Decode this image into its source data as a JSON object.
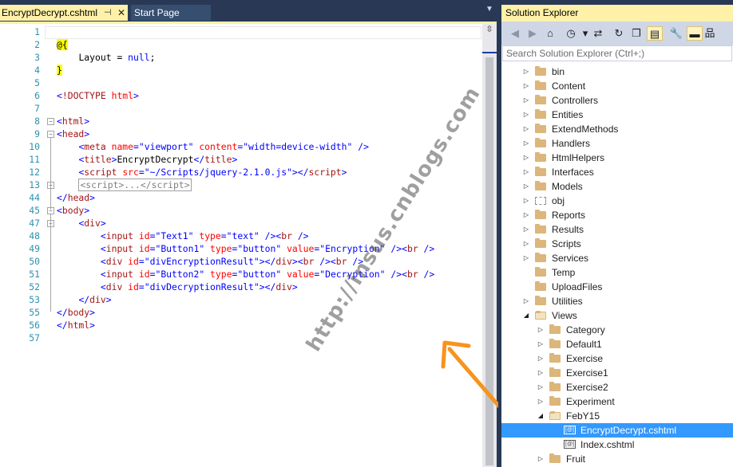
{
  "tabs": [
    {
      "label": "EncryptDecrypt.cshtml",
      "active": true
    },
    {
      "label": "Start Page",
      "active": false
    }
  ],
  "icons": {
    "pin": "⊣",
    "close": "✕",
    "dropdown": "▼",
    "split": "⇳",
    "fold_open": "−",
    "fold_closed": "+"
  },
  "editor": {
    "lines": [
      {
        "num": "1",
        "html": ""
      },
      {
        "num": "2",
        "html": "<span class=\"razor\">@{</span>"
      },
      {
        "num": "3",
        "html": "    <span class=\"txt\">Layout = </span><span class=\"kw\">null</span><span class=\"txt\">;</span>"
      },
      {
        "num": "4",
        "html": "<span class=\"razor\">}</span>"
      },
      {
        "num": "5",
        "html": ""
      },
      {
        "num": "6",
        "html": "<span class=\"val\">&lt;</span><span class=\"tag\">!DOCTYPE</span> <span class=\"attr\">html</span><span class=\"val\">&gt;</span>"
      },
      {
        "num": "7",
        "html": ""
      },
      {
        "num": "8",
        "html": "<span class=\"val\">&lt;</span><span class=\"tag\">html</span><span class=\"val\">&gt;</span>"
      },
      {
        "num": "9",
        "html": "<span class=\"val\">&lt;</span><span class=\"tag\">head</span><span class=\"val\">&gt;</span>"
      },
      {
        "num": "10",
        "html": "    <span class=\"val\">&lt;</span><span class=\"tag\">meta</span> <span class=\"attr\">name</span><span class=\"val\">=\"viewport\"</span> <span class=\"attr\">content</span><span class=\"val\">=\"width=device-width\"</span> <span class=\"val\">/&gt;</span>"
      },
      {
        "num": "11",
        "html": "    <span class=\"val\">&lt;</span><span class=\"tag\">title</span><span class=\"val\">&gt;</span><span class=\"txt\">EncryptDecrypt</span><span class=\"val\">&lt;/</span><span class=\"tag\">title</span><span class=\"val\">&gt;</span>"
      },
      {
        "num": "12",
        "html": "    <span class=\"val\">&lt;</span><span class=\"tag\">script</span> <span class=\"attr\">src</span><span class=\"val\">=\"~/Scripts/jquery-2.1.0.js\"</span><span class=\"val\">&gt;&lt;/</span><span class=\"tag\">script</span><span class=\"val\">&gt;</span>"
      },
      {
        "num": "13",
        "html": "    <span class=\"collapsed\">&lt;script&gt;...&lt;/script&gt;</span>"
      },
      {
        "num": "44",
        "html": "<span class=\"val\">&lt;/</span><span class=\"tag\">head</span><span class=\"val\">&gt;</span>"
      },
      {
        "num": "45",
        "html": "<span class=\"val\">&lt;</span><span class=\"tag\">body</span><span class=\"val\">&gt;</span>"
      },
      {
        "num": "47",
        "html": "    <span class=\"val\">&lt;</span><span class=\"tag\">div</span><span class=\"val\">&gt;</span>"
      },
      {
        "num": "48",
        "html": "        <span class=\"val\">&lt;</span><span class=\"tag\">input</span> <span class=\"attr\">id</span><span class=\"val\">=\"Text1\"</span> <span class=\"attr\">type</span><span class=\"val\">=\"text\"</span> <span class=\"val\">/&gt;&lt;</span><span class=\"tag\">br</span> <span class=\"val\">/&gt;</span>"
      },
      {
        "num": "49",
        "html": "        <span class=\"val\">&lt;</span><span class=\"tag\">input</span> <span class=\"attr\">id</span><span class=\"val\">=\"Button1\"</span> <span class=\"attr\">type</span><span class=\"val\">=\"button\"</span> <span class=\"attr\">value</span><span class=\"val\">=\"Encryption\"</span> <span class=\"val\">/&gt;&lt;</span><span class=\"tag\">br</span> <span class=\"val\">/&gt;</span>"
      },
      {
        "num": "50",
        "html": "        <span class=\"val\">&lt;</span><span class=\"tag\">div</span> <span class=\"attr\">id</span><span class=\"val\">=\"divEncryptionResult\"</span><span class=\"val\">&gt;&lt;/</span><span class=\"tag\">div</span><span class=\"val\">&gt;&lt;</span><span class=\"tag\">br</span> <span class=\"val\">/&gt;&lt;</span><span class=\"tag\">br</span> <span class=\"val\">/&gt;</span>"
      },
      {
        "num": "51",
        "html": "        <span class=\"val\">&lt;</span><span class=\"tag\">input</span> <span class=\"attr\">id</span><span class=\"val\">=\"Button2\"</span> <span class=\"attr\">type</span><span class=\"val\">=\"button\"</span> <span class=\"attr\">value</span><span class=\"val\">=\"Decryption\"</span> <span class=\"val\">/&gt;&lt;</span><span class=\"tag\">br</span> <span class=\"val\">/&gt;</span>"
      },
      {
        "num": "52",
        "html": "        <span class=\"val\">&lt;</span><span class=\"tag\">div</span> <span class=\"attr\">id</span><span class=\"val\">=\"divDecryptionResult\"</span><span class=\"val\">&gt;&lt;/</span><span class=\"tag\">div</span><span class=\"val\">&gt;</span>"
      },
      {
        "num": "53",
        "html": "    <span class=\"val\">&lt;/</span><span class=\"tag\">div</span><span class=\"val\">&gt;</span>"
      },
      {
        "num": "55",
        "html": "<span class=\"val\">&lt;/</span><span class=\"tag\">body</span><span class=\"val\">&gt;</span>"
      },
      {
        "num": "56",
        "html": "<span class=\"val\">&lt;/</span><span class=\"tag\">html</span><span class=\"val\">&gt;</span>"
      },
      {
        "num": "57",
        "html": ""
      }
    ]
  },
  "watermark": "http://insus.cnblogs.com",
  "solution_explorer": {
    "title": "Solution Explorer",
    "search_placeholder": "Search Solution Explorer (Ctrl+;)",
    "toolbar_icons": [
      "back-icon",
      "forward-icon",
      "home-icon",
      "history-icon",
      "dropdown-icon",
      "sync-icon",
      "refresh-icon",
      "collapse-all-icon",
      "show-all-files-icon",
      "properties-icon",
      "pin-preview-icon",
      "class-view-icon"
    ],
    "toolbar_glyphs": [
      "◀",
      "▶",
      "⌂",
      "◷",
      "▾",
      "⇄",
      "↻",
      "❐",
      "▤",
      "🔧",
      "▬",
      "品"
    ],
    "tree": [
      {
        "label": "bin",
        "level": 0,
        "state": "collapsed",
        "icon": "folder"
      },
      {
        "label": "Content",
        "level": 0,
        "state": "collapsed",
        "icon": "folder"
      },
      {
        "label": "Controllers",
        "level": 0,
        "state": "collapsed",
        "icon": "folder"
      },
      {
        "label": "Entities",
        "level": 0,
        "state": "collapsed",
        "icon": "folder"
      },
      {
        "label": "ExtendMethods",
        "level": 0,
        "state": "collapsed",
        "icon": "folder"
      },
      {
        "label": "Handlers",
        "level": 0,
        "state": "collapsed",
        "icon": "folder"
      },
      {
        "label": "HtmlHelpers",
        "level": 0,
        "state": "collapsed",
        "icon": "folder"
      },
      {
        "label": "Interfaces",
        "level": 0,
        "state": "collapsed",
        "icon": "folder"
      },
      {
        "label": "Models",
        "level": 0,
        "state": "collapsed",
        "icon": "folder"
      },
      {
        "label": "obj",
        "level": 0,
        "state": "collapsed",
        "icon": "folder-dotted"
      },
      {
        "label": "Reports",
        "level": 0,
        "state": "collapsed",
        "icon": "folder"
      },
      {
        "label": "Results",
        "level": 0,
        "state": "collapsed",
        "icon": "folder"
      },
      {
        "label": "Scripts",
        "level": 0,
        "state": "collapsed",
        "icon": "folder"
      },
      {
        "label": "Services",
        "level": 0,
        "state": "collapsed",
        "icon": "folder"
      },
      {
        "label": "Temp",
        "level": 0,
        "state": "none",
        "icon": "folder"
      },
      {
        "label": "UploadFiles",
        "level": 0,
        "state": "none",
        "icon": "folder"
      },
      {
        "label": "Utilities",
        "level": 0,
        "state": "collapsed",
        "icon": "folder"
      },
      {
        "label": "Views",
        "level": 0,
        "state": "expanded",
        "icon": "folder-open"
      },
      {
        "label": "Category",
        "level": 1,
        "state": "collapsed",
        "icon": "folder"
      },
      {
        "label": "Default1",
        "level": 1,
        "state": "collapsed",
        "icon": "folder"
      },
      {
        "label": "Exercise",
        "level": 1,
        "state": "collapsed",
        "icon": "folder"
      },
      {
        "label": "Exercise1",
        "level": 1,
        "state": "collapsed",
        "icon": "folder"
      },
      {
        "label": "Exercise2",
        "level": 1,
        "state": "collapsed",
        "icon": "folder"
      },
      {
        "label": "Experiment",
        "level": 1,
        "state": "collapsed",
        "icon": "folder"
      },
      {
        "label": "FebY15",
        "level": 1,
        "state": "expanded",
        "icon": "folder-open"
      },
      {
        "label": "EncryptDecrypt.cshtml",
        "level": 2,
        "state": "none",
        "icon": "file",
        "selected": true
      },
      {
        "label": "Index.cshtml",
        "level": 2,
        "state": "none",
        "icon": "file"
      },
      {
        "label": "Fruit",
        "level": 1,
        "state": "collapsed",
        "icon": "folder"
      }
    ],
    "glyphs": {
      "collapsed": "▷",
      "expanded": "◢",
      "file": "[@]"
    }
  }
}
